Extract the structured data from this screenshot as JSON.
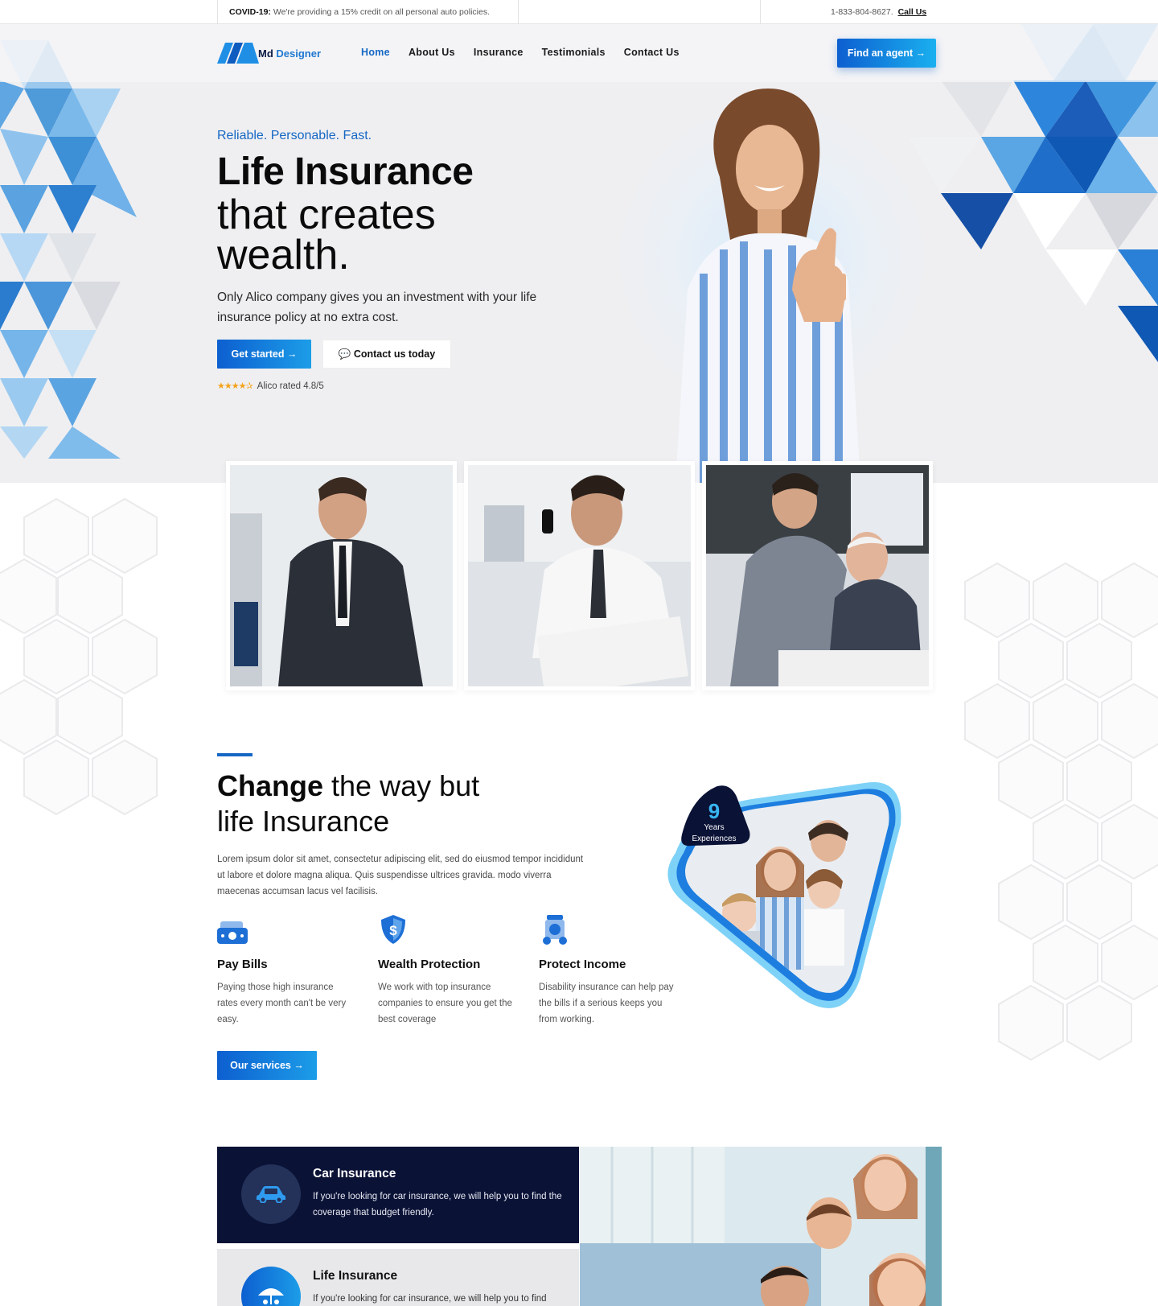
{
  "topbar": {
    "covid_label": "COVID-19:",
    "covid_text": "We're providing a 15% credit on all personal auto policies.",
    "phone": "1-833-804-8627.",
    "call_label": "Call Us"
  },
  "header": {
    "logo_md": "Md",
    "logo_designer": "Designer",
    "nav": [
      "Home",
      "About Us",
      "Insurance",
      "Testimonials",
      "Contact Us"
    ],
    "cta": "Find an agent →"
  },
  "hero": {
    "tagline": "Reliable. Personable. Fast.",
    "title_bold": "Life Insurance",
    "title_light": "that creates wealth.",
    "description": "Only Alico company gives you an investment with your life insurance policy at no extra cost.",
    "primary_button": "Get started →",
    "secondary_button": "💬 Contact us today",
    "stars": "★★★★✰",
    "rating_text": "Alico rated 4.8/5"
  },
  "about": {
    "title_bold": "Change",
    "title_rest": " the way but",
    "title_line2": "life Insurance",
    "description": "Lorem ipsum dolor sit amet, consectetur adipiscing elit, sed do eiusmod tempor incididunt ut labore et dolore magna aliqua. Quis suspendisse ultrices gravida. modo viverra maecenas accumsan lacus vel facilisis.",
    "features": [
      {
        "icon": "money-bills-icon",
        "title": "Pay Bills",
        "text": "Paying those high insurance rates every month can't be very easy."
      },
      {
        "icon": "dollar-shield-icon",
        "title": "Wealth Protection",
        "text": "We work with top insurance companies to ensure you get the best coverage"
      },
      {
        "icon": "income-protection-icon",
        "title": "Protect Income",
        "text": "Disability insurance can help pay the bills if a serious keeps you from working."
      }
    ],
    "button": "Our services →",
    "badge_number": "9",
    "badge_line1": "Years",
    "badge_line2": "Experiences"
  },
  "insurance": [
    {
      "icon": "car-icon",
      "title": "Car Insurance",
      "text": "If you're looking for car insurance, we will help you to find the coverage that budget friendly."
    },
    {
      "icon": "umbrella-family-icon",
      "title": "Life Insurance",
      "text": "If you're looking for car insurance, we will help you to find"
    }
  ],
  "colors": {
    "brand_blue": "#1567c4",
    "navy": "#0a1236",
    "star": "#f4a31b"
  }
}
